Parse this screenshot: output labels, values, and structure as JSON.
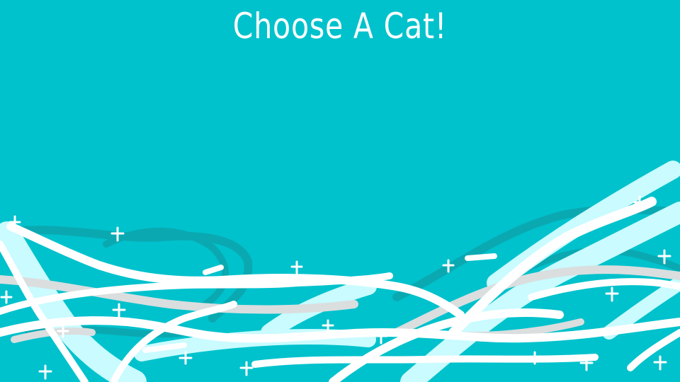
{
  "screen": {
    "title": "Choose A Cat!",
    "background_color": "#00c2cc"
  },
  "decoration": {
    "style": "hand-drawn white ribbons with small sparkles along the bottom",
    "colors": [
      "#ffffff",
      "#c9fbff",
      "#dadedf",
      "#0aa9b2"
    ]
  }
}
